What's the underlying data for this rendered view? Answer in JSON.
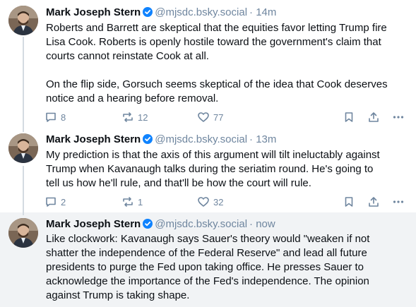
{
  "posts": [
    {
      "author": "Mark Joseph Stern",
      "handle": "@mjsdc.bsky.social",
      "time": "· 14m",
      "text": "Roberts and Barrett are skeptical that the equities favor letting Trump fire\nLisa Cook. Roberts is openly hostile toward the government's claim that\ncourts cannot reinstate Cook at all.\n\nOn the flip side, Gorsuch seems skeptical of the idea that Cook deserves\nnotice and a hearing before removal.",
      "replies": "8",
      "reposts": "12",
      "likes": "77"
    },
    {
      "author": "Mark Joseph Stern",
      "handle": "@mjsdc.bsky.social",
      "time": "· 13m",
      "text": "My prediction is that the axis of this argument will tilt ineluctably against\nTrump when Kavanaugh talks during the seriatim round. He's going to\ntell us how he'll rule, and that'll be how the court will rule.",
      "replies": "2",
      "reposts": "1",
      "likes": "32"
    },
    {
      "author": "Mark Joseph Stern",
      "handle": "@mjsdc.bsky.social",
      "time": "· now",
      "text": "Like clockwork: Kavanaugh says Sauer's theory would \"weaken if not\nshatter the independence of the Federal Reserve\" and lead all future\npresidents to purge the Fed upon taking office. He presses Sauer to\nacknowledge the importance of the Fed's independence. The opinion\nagainst Trump is taking shape."
    }
  ],
  "icons": {
    "verified": "verified-badge-icon",
    "reply": "speech-bubble-icon",
    "repost": "repost-arrows-icon",
    "like": "heart-icon",
    "bookmark": "bookmark-icon",
    "share": "share-icon",
    "more": "more-dots-icon"
  },
  "colors": {
    "accent": "#1083fe",
    "muted": "#6f869f",
    "highlight_bg": "#f1f3f5",
    "thread_line": "#d4dbe2"
  }
}
